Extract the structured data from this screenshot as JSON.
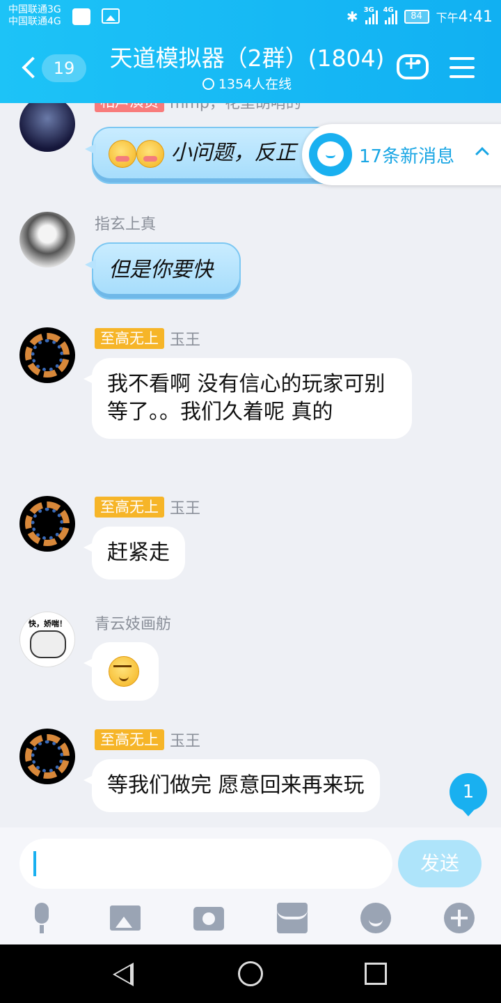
{
  "status_bar": {
    "carrier1": "中国联通3G",
    "carrier2": "中国联通4G",
    "net1": "3G",
    "net2": "4G",
    "battery": "84",
    "time_prefix": "下午",
    "time": "4:41"
  },
  "header": {
    "unread_count": "19",
    "title": "天道模拟器（2群）(1804)",
    "online": "1354人在线"
  },
  "new_messages": {
    "label": "17条新消息"
  },
  "messages": [
    {
      "badge": "相声演员",
      "sender": "mmp，花里胡哨的",
      "text": "小问题，反正"
    },
    {
      "badge": "",
      "sender": "指玄上真",
      "text": "但是你要快"
    },
    {
      "badge": "至高无上",
      "sender": "玉王",
      "text": "我不看啊  没有信心的玩家可别等了。。我们久着呢 真的"
    },
    {
      "badge": "至高无上",
      "sender": "玉王",
      "text": "赶紧走"
    },
    {
      "badge": "",
      "sender": "青云妓画舫",
      "text": "",
      "avatar_text": "快，娇喘！"
    },
    {
      "badge": "至高无上",
      "sender": "玉王",
      "text": "等我们做完 愿意回来再来玩"
    }
  ],
  "unread_bubble": "1",
  "input": {
    "value": "",
    "send_label": "发送"
  },
  "colors": {
    "accent": "#19b0f0",
    "badge_gold": "#f6b528",
    "badge_pink": "#f87b7b"
  }
}
